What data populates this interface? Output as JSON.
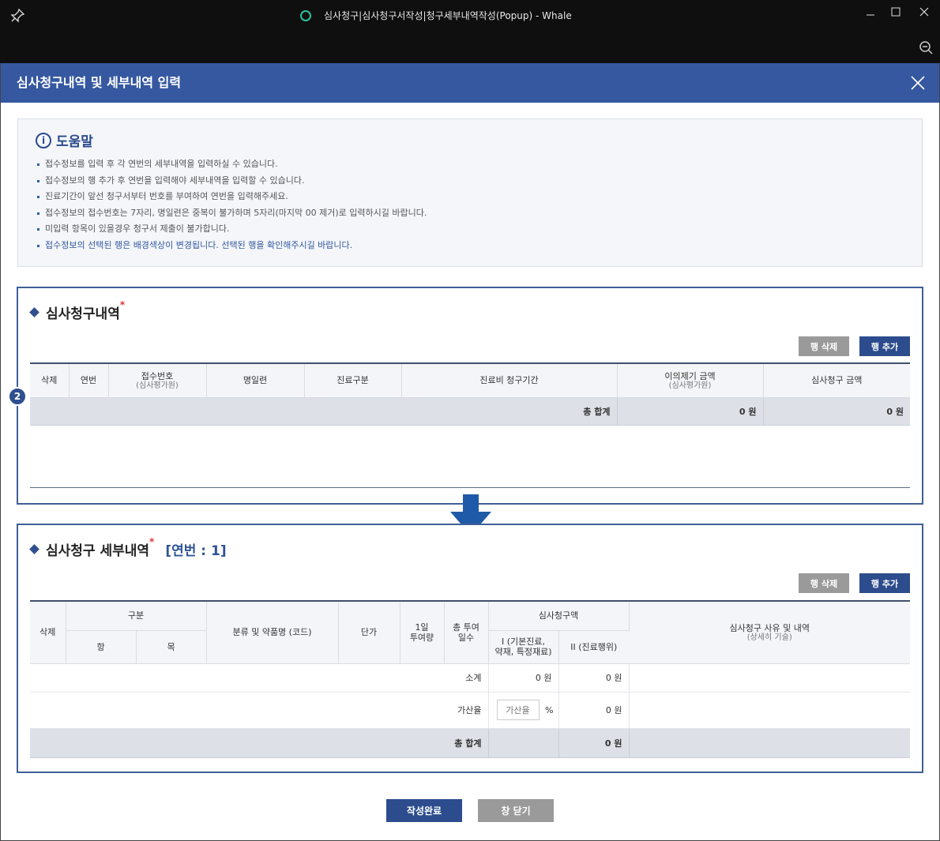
{
  "window": {
    "title": "심사청구|심사청구서작성|청구세부내역작성(Popup) - Whale",
    "minimize": "—",
    "maximize": "☐",
    "close": "✕"
  },
  "dialog": {
    "title": "심사청구내역 및 세부내역 입력"
  },
  "help": {
    "title": "도움말",
    "items": [
      "접수정보를 입력 후 각 연번의 세부내역을 입력하실 수 있습니다.",
      "접수정보의 행 추가 후 연번을 입력해야 세부내역을 입력할 수 있습니다.",
      "진료기간이 앞선 청구서부터 번호를 부여하여 연번을 입력해주세요.",
      "접수정보의 접수번호는 7자리, 명일련은 중복이 불가하며 5자리(마지막 00 제거)로 입력하시길 바랍니다.",
      "미입력 항목이 있을경우 청구서 제출이 불가합니다.",
      "접수정보의 선택된 행은 배경색상이 변경됩니다. 선택된 행을 확인해주시길 바랍니다."
    ]
  },
  "claims": {
    "title": "심사청구내역",
    "required_mark": "*",
    "delete_row": "행 삭제",
    "add_row": "행 추가",
    "badge": "2",
    "headers": {
      "delete": "삭제",
      "serial": "연번",
      "receipt_no": "접수번호",
      "receipt_no_sub": "(심사평가원)",
      "name_serial": "명일련",
      "care_type": "진료구분",
      "period": "진료비 청구기간",
      "objection_amount": "이의제기 금액",
      "objection_amount_sub": "(심사평가원)",
      "claim_amount": "심사청구 금액"
    },
    "total_label": "총 합계",
    "total_objection": "0 원",
    "total_claim": "0 원"
  },
  "details": {
    "title": "심사청구 세부내역",
    "required_mark": "*",
    "serial_label": "[연번 : 1]",
    "delete_row": "행 삭제",
    "add_row": "행 추가",
    "headers": {
      "delete": "삭제",
      "category": "구분",
      "item": "항",
      "subitem": "목",
      "drug_name": "분류 및 약품명 (코드)",
      "unit_price": "단가",
      "daily_dose": "1일\n투여량",
      "total_days": "총 투여\n일수",
      "claim_amount": "심사청구액",
      "amount_1": "I (기본진료,\n약재, 특정재료)",
      "amount_2": "II (진료행위)",
      "reason": "심사청구 사유 및 내역",
      "reason_sub": "(상세히 기술)"
    },
    "subtotal_label": "소계",
    "subtotal_1": "0 원",
    "subtotal_2": "0 원",
    "rate_label": "가산율",
    "rate_placeholder": "가산율",
    "rate_unit": "%",
    "rate_amount": "0 원",
    "total_label": "총 합계",
    "total_amount": "0 원"
  },
  "footer": {
    "submit": "작성완료",
    "close": "창 닫기"
  },
  "colors": {
    "header_bg": "#3558a0",
    "navy_button": "#2d4c8d",
    "gray_button": "#9a9a9a",
    "required": "#e0343a"
  }
}
